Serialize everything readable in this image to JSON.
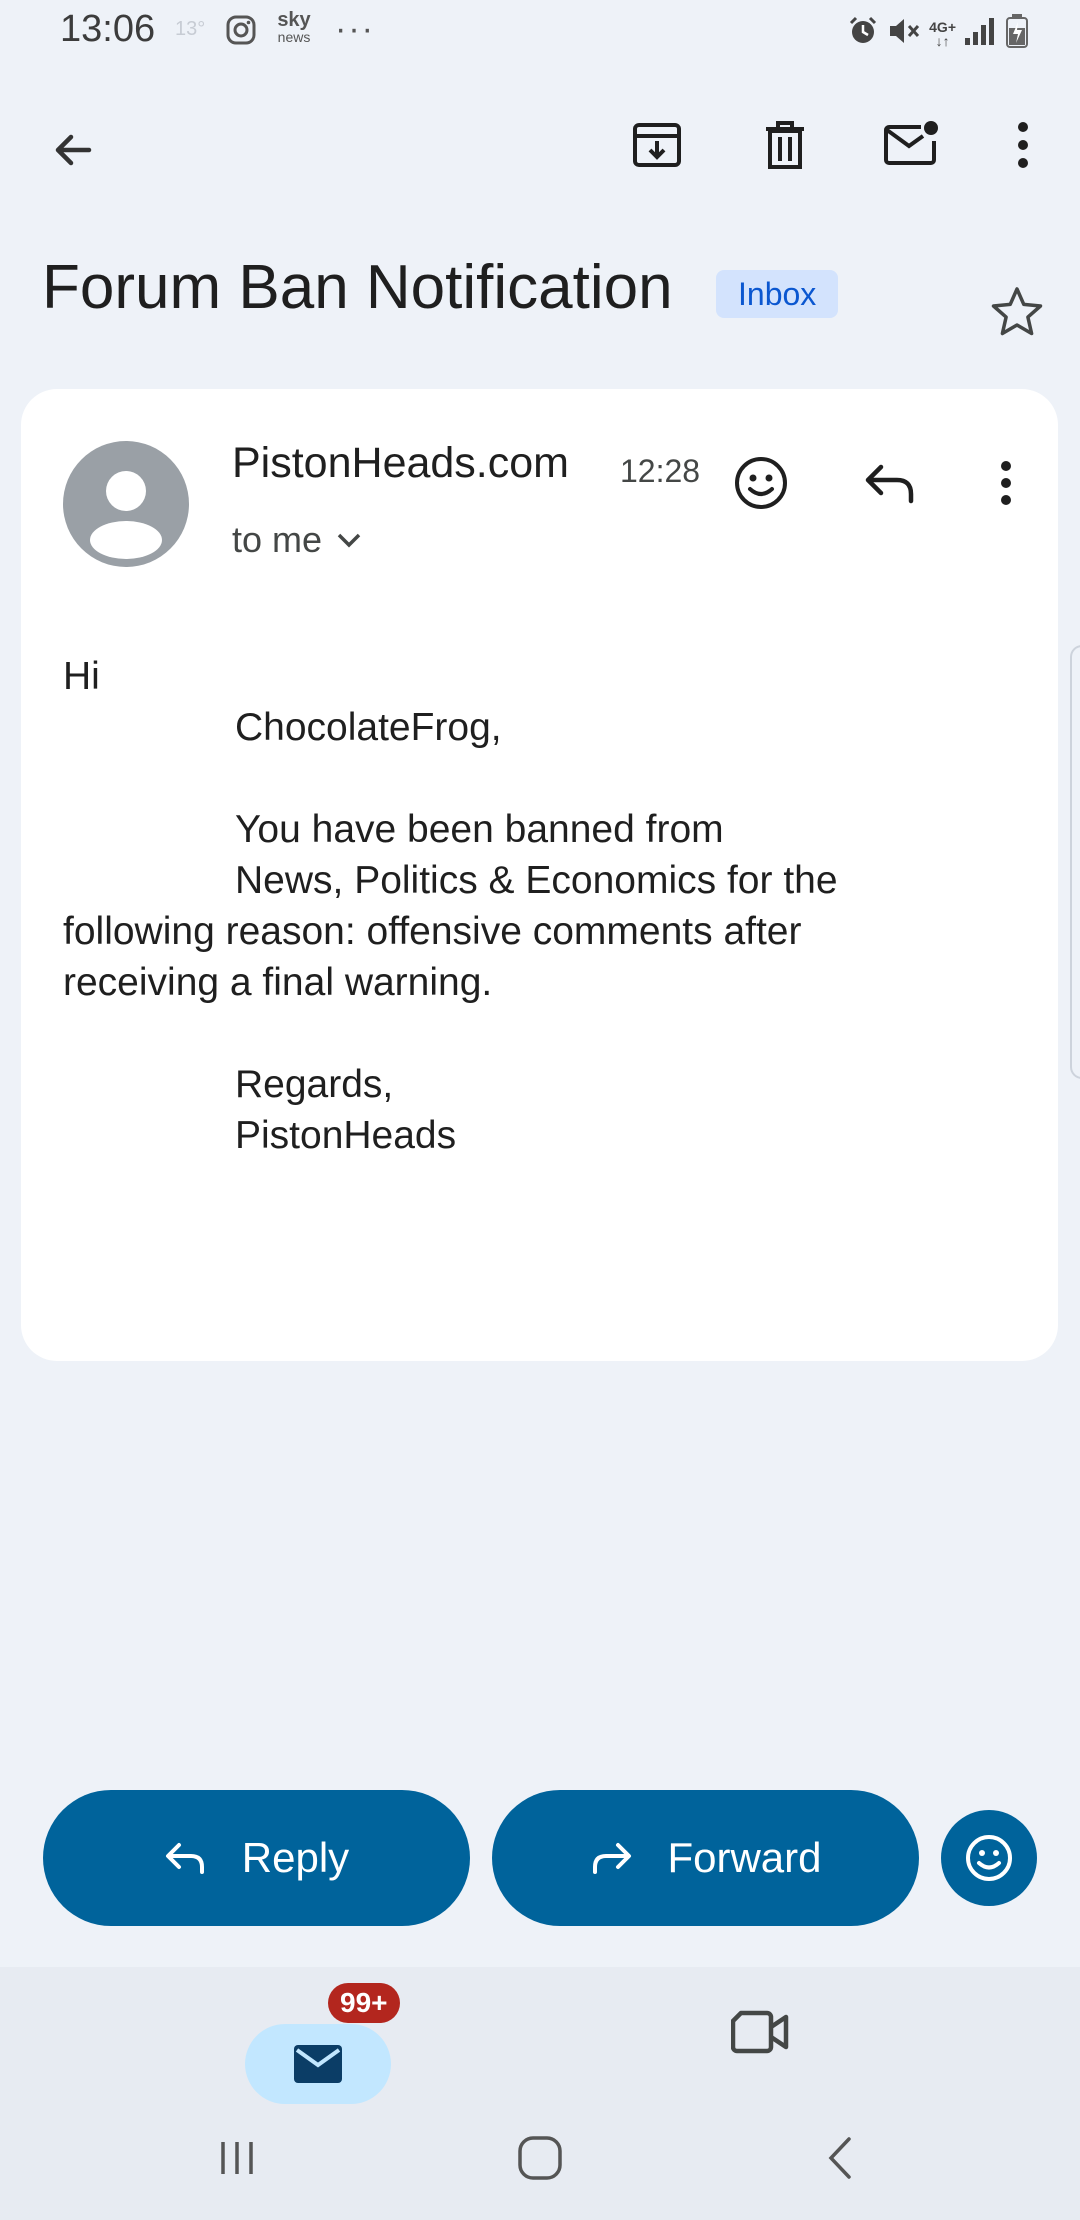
{
  "status_bar": {
    "time": "13:06",
    "temperature": "13°",
    "sky_top": "sky",
    "sky_bottom": "news",
    "more": "···",
    "network": "4G+"
  },
  "toolbar": {
    "icons": [
      "back-arrow-icon",
      "archive-icon",
      "trash-icon",
      "mark-unread-icon",
      "more-vert-icon"
    ]
  },
  "email": {
    "subject": "Forum Ban Notification",
    "label": "Inbox",
    "sender": "PistonHeads.com",
    "time": "12:28",
    "recipient": "to me",
    "body": {
      "greeting": "Hi",
      "name": "ChocolateFrog,",
      "line1": "You have been banned from",
      "line2": "News, Politics & Economics for the",
      "line3": "following reason: offensive comments after",
      "line4": "receiving a final warning.",
      "closing": "Regards,",
      "signature": "PistonHeads"
    }
  },
  "actions": {
    "reply_label": "Reply",
    "forward_label": "Forward"
  },
  "bottom_nav": {
    "mail_badge": "99+"
  },
  "colors": {
    "background": "#eef2f8",
    "accent": "#00639b",
    "chip_bg": "#d3e3fd",
    "chip_text": "#0b57d0",
    "badge": "#b3261e"
  }
}
